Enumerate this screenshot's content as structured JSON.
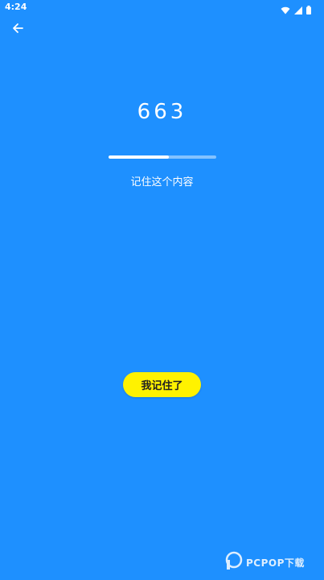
{
  "status_bar": {
    "time": "4:24",
    "icons": [
      "wifi-icon",
      "signal-icon",
      "battery-icon"
    ]
  },
  "header": {
    "back_icon": "arrow-left-icon"
  },
  "memory": {
    "number": "663",
    "progress_percent": 56,
    "instruction": "记住这个内容"
  },
  "actions": {
    "remember_label": "我记住了"
  },
  "watermark": {
    "text": "PCPOP下载"
  },
  "colors": {
    "background": "#1e90ff",
    "button": "#fff200",
    "text": "#ffffff"
  }
}
